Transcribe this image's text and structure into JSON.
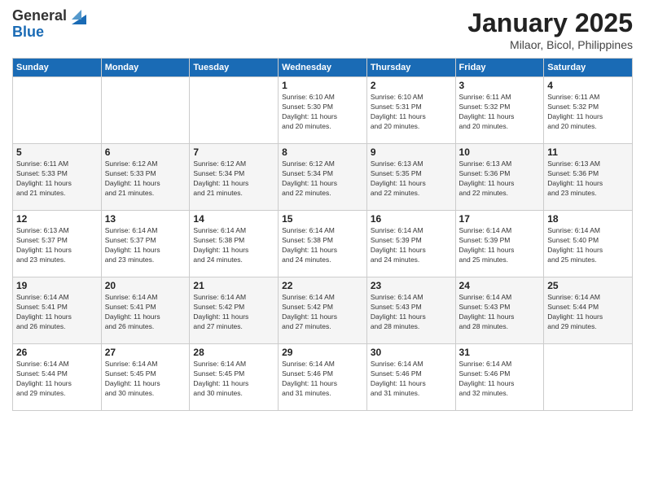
{
  "logo": {
    "general": "General",
    "blue": "Blue"
  },
  "title": "January 2025",
  "location": "Milaor, Bicol, Philippines",
  "days_of_week": [
    "Sunday",
    "Monday",
    "Tuesday",
    "Wednesday",
    "Thursday",
    "Friday",
    "Saturday"
  ],
  "weeks": [
    [
      {
        "day": "",
        "info": ""
      },
      {
        "day": "",
        "info": ""
      },
      {
        "day": "",
        "info": ""
      },
      {
        "day": "1",
        "info": "Sunrise: 6:10 AM\nSunset: 5:30 PM\nDaylight: 11 hours\nand 20 minutes."
      },
      {
        "day": "2",
        "info": "Sunrise: 6:10 AM\nSunset: 5:31 PM\nDaylight: 11 hours\nand 20 minutes."
      },
      {
        "day": "3",
        "info": "Sunrise: 6:11 AM\nSunset: 5:32 PM\nDaylight: 11 hours\nand 20 minutes."
      },
      {
        "day": "4",
        "info": "Sunrise: 6:11 AM\nSunset: 5:32 PM\nDaylight: 11 hours\nand 20 minutes."
      }
    ],
    [
      {
        "day": "5",
        "info": "Sunrise: 6:11 AM\nSunset: 5:33 PM\nDaylight: 11 hours\nand 21 minutes."
      },
      {
        "day": "6",
        "info": "Sunrise: 6:12 AM\nSunset: 5:33 PM\nDaylight: 11 hours\nand 21 minutes."
      },
      {
        "day": "7",
        "info": "Sunrise: 6:12 AM\nSunset: 5:34 PM\nDaylight: 11 hours\nand 21 minutes."
      },
      {
        "day": "8",
        "info": "Sunrise: 6:12 AM\nSunset: 5:34 PM\nDaylight: 11 hours\nand 22 minutes."
      },
      {
        "day": "9",
        "info": "Sunrise: 6:13 AM\nSunset: 5:35 PM\nDaylight: 11 hours\nand 22 minutes."
      },
      {
        "day": "10",
        "info": "Sunrise: 6:13 AM\nSunset: 5:36 PM\nDaylight: 11 hours\nand 22 minutes."
      },
      {
        "day": "11",
        "info": "Sunrise: 6:13 AM\nSunset: 5:36 PM\nDaylight: 11 hours\nand 23 minutes."
      }
    ],
    [
      {
        "day": "12",
        "info": "Sunrise: 6:13 AM\nSunset: 5:37 PM\nDaylight: 11 hours\nand 23 minutes."
      },
      {
        "day": "13",
        "info": "Sunrise: 6:14 AM\nSunset: 5:37 PM\nDaylight: 11 hours\nand 23 minutes."
      },
      {
        "day": "14",
        "info": "Sunrise: 6:14 AM\nSunset: 5:38 PM\nDaylight: 11 hours\nand 24 minutes."
      },
      {
        "day": "15",
        "info": "Sunrise: 6:14 AM\nSunset: 5:38 PM\nDaylight: 11 hours\nand 24 minutes."
      },
      {
        "day": "16",
        "info": "Sunrise: 6:14 AM\nSunset: 5:39 PM\nDaylight: 11 hours\nand 24 minutes."
      },
      {
        "day": "17",
        "info": "Sunrise: 6:14 AM\nSunset: 5:39 PM\nDaylight: 11 hours\nand 25 minutes."
      },
      {
        "day": "18",
        "info": "Sunrise: 6:14 AM\nSunset: 5:40 PM\nDaylight: 11 hours\nand 25 minutes."
      }
    ],
    [
      {
        "day": "19",
        "info": "Sunrise: 6:14 AM\nSunset: 5:41 PM\nDaylight: 11 hours\nand 26 minutes."
      },
      {
        "day": "20",
        "info": "Sunrise: 6:14 AM\nSunset: 5:41 PM\nDaylight: 11 hours\nand 26 minutes."
      },
      {
        "day": "21",
        "info": "Sunrise: 6:14 AM\nSunset: 5:42 PM\nDaylight: 11 hours\nand 27 minutes."
      },
      {
        "day": "22",
        "info": "Sunrise: 6:14 AM\nSunset: 5:42 PM\nDaylight: 11 hours\nand 27 minutes."
      },
      {
        "day": "23",
        "info": "Sunrise: 6:14 AM\nSunset: 5:43 PM\nDaylight: 11 hours\nand 28 minutes."
      },
      {
        "day": "24",
        "info": "Sunrise: 6:14 AM\nSunset: 5:43 PM\nDaylight: 11 hours\nand 28 minutes."
      },
      {
        "day": "25",
        "info": "Sunrise: 6:14 AM\nSunset: 5:44 PM\nDaylight: 11 hours\nand 29 minutes."
      }
    ],
    [
      {
        "day": "26",
        "info": "Sunrise: 6:14 AM\nSunset: 5:44 PM\nDaylight: 11 hours\nand 29 minutes."
      },
      {
        "day": "27",
        "info": "Sunrise: 6:14 AM\nSunset: 5:45 PM\nDaylight: 11 hours\nand 30 minutes."
      },
      {
        "day": "28",
        "info": "Sunrise: 6:14 AM\nSunset: 5:45 PM\nDaylight: 11 hours\nand 30 minutes."
      },
      {
        "day": "29",
        "info": "Sunrise: 6:14 AM\nSunset: 5:46 PM\nDaylight: 11 hours\nand 31 minutes."
      },
      {
        "day": "30",
        "info": "Sunrise: 6:14 AM\nSunset: 5:46 PM\nDaylight: 11 hours\nand 31 minutes."
      },
      {
        "day": "31",
        "info": "Sunrise: 6:14 AM\nSunset: 5:46 PM\nDaylight: 11 hours\nand 32 minutes."
      },
      {
        "day": "",
        "info": ""
      }
    ]
  ]
}
